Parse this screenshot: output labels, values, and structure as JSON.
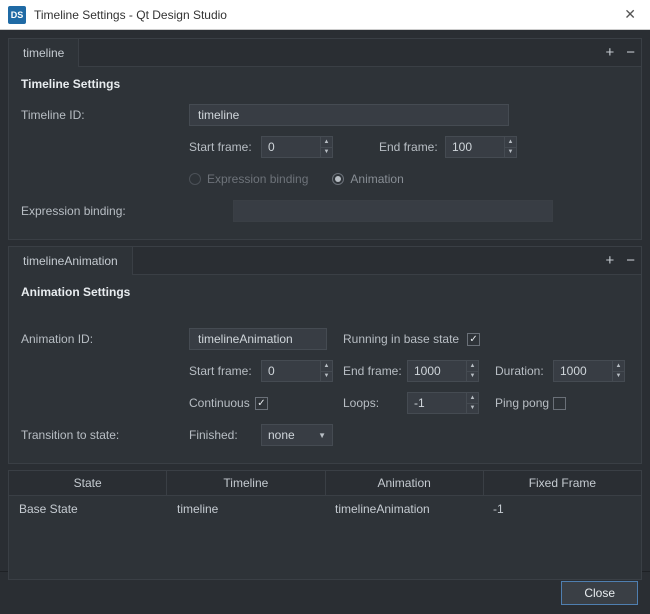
{
  "window": {
    "app_badge": "DS",
    "title": "Timeline Settings - Qt Design Studio"
  },
  "timeline_panel": {
    "tab_label": "timeline",
    "section_title": "Timeline Settings",
    "id_label": "Timeline ID:",
    "id_value": "timeline",
    "start_frame_label": "Start frame:",
    "start_frame_value": "0",
    "end_frame_label": "End frame:",
    "end_frame_value": "100",
    "radio_expr": "Expression binding",
    "radio_anim": "Animation",
    "expr_label": "Expression binding:"
  },
  "anim_panel": {
    "tab_label": "timelineAnimation",
    "section_title": "Animation Settings",
    "id_label": "Animation ID:",
    "id_value": "timelineAnimation",
    "running_label": "Running in base state",
    "start_frame_label": "Start frame:",
    "start_frame_value": "0",
    "end_frame_label": "End frame:",
    "end_frame_value": "1000",
    "duration_label": "Duration:",
    "duration_value": "1000",
    "continuous_label": "Continuous",
    "loops_label": "Loops:",
    "loops_value": "-1",
    "pingpong_label": "Ping pong",
    "transition_label": "Transition to state:",
    "finished_label": "Finished:",
    "finished_value": "none"
  },
  "table": {
    "headers": {
      "state": "State",
      "timeline": "Timeline",
      "animation": "Animation",
      "fixed": "Fixed Frame"
    },
    "row": {
      "state": "Base State",
      "timeline": "timeline",
      "animation": "timelineAnimation",
      "fixed": "-1"
    }
  },
  "footer": {
    "close": "Close"
  }
}
